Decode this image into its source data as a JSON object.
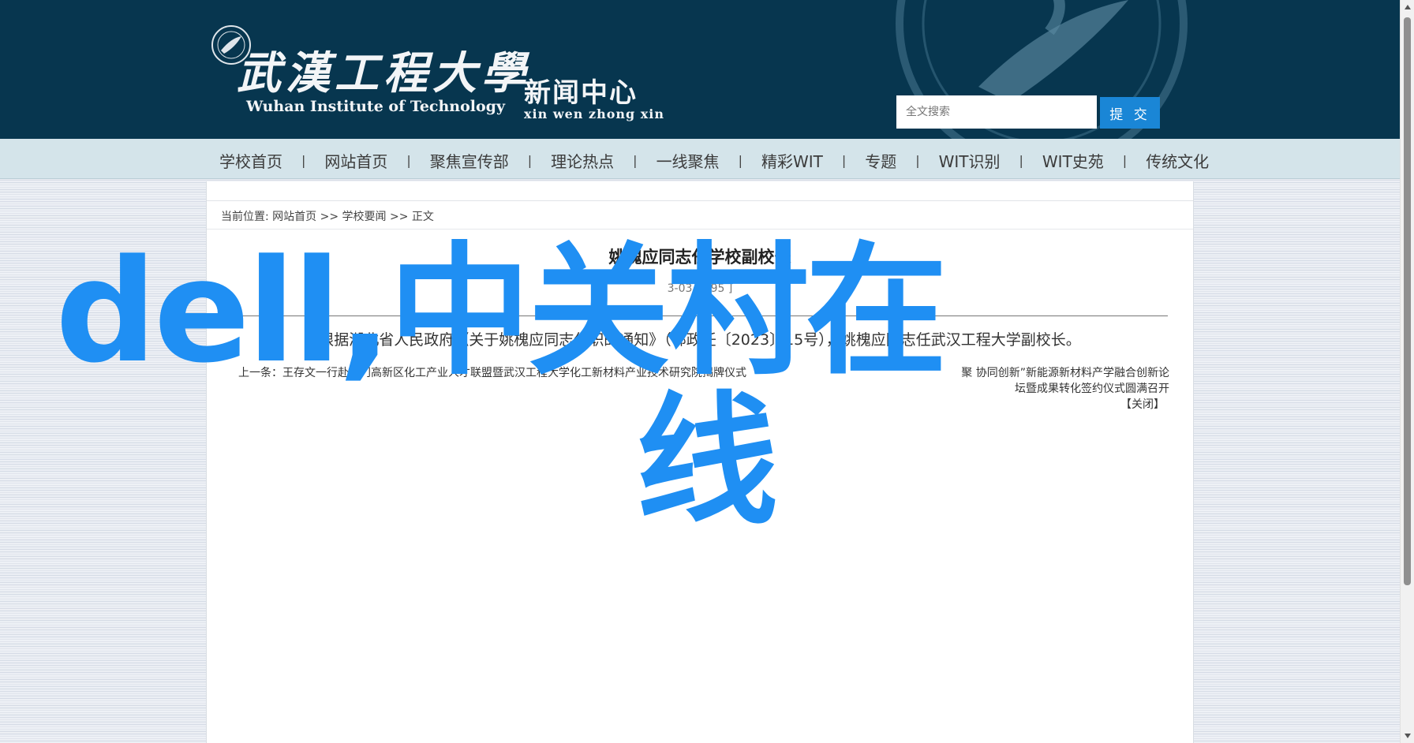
{
  "header": {
    "logo_cn": "武漢工程大學",
    "logo_en": "Wuhan Institute of Technology",
    "news_cn": "新闻中心",
    "news_en": "xin wen zhong xin",
    "search": {
      "placeholder": "全文搜索",
      "button": "提 交"
    }
  },
  "nav": {
    "items": [
      "学校首页",
      "网站首页",
      "聚焦宣传部",
      "理论热点",
      "一线聚焦",
      "精彩WIT",
      "专题",
      "WIT识别",
      "WIT史苑",
      "传统文化"
    ],
    "separator": "|"
  },
  "breadcrumb": {
    "prefix": "当前位置:",
    "items": [
      "网站首页",
      "学校要闻",
      "正文"
    ],
    "separator": ">>"
  },
  "article": {
    "title": "姚槐应同志任学校副校长",
    "meta": "3-03  [ 495 ]",
    "body": "根据湖北省人民政府《关于姚槐应同志任职的通知》（鄂政任〔2023〕15号），姚槐应同志任武汉工程大学副校长。",
    "prev": "上一条：王存文一行赴荆门高新区化工产业人才联盟暨武汉工程大学化工新材料产业技术研究院揭牌仪式",
    "next": "聚 协同创新”新能源新材料产学融合创新论",
    "next_cont": "坛暨成果转化签约仪式圆满召开",
    "close": "【关闭】"
  },
  "overlay": {
    "line1": "dell,中关村在",
    "line2": "线"
  },
  "colors": {
    "header_bg": "#07364f",
    "nav_bg": "#d4e4ea",
    "search_button": "#1a86d6",
    "overlay_text": "#1f8ff3"
  }
}
